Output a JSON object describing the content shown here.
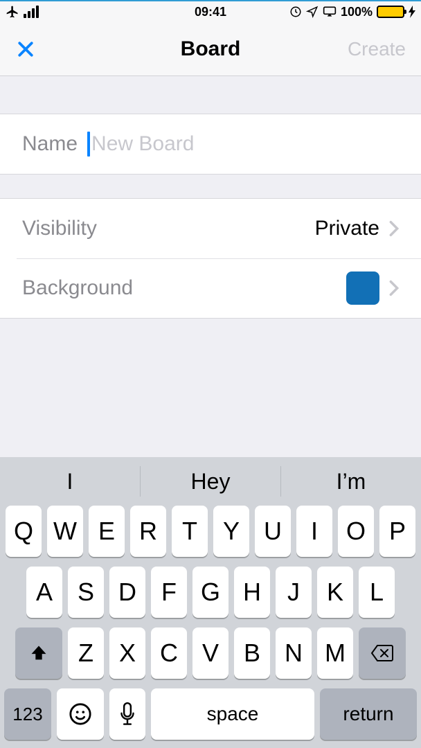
{
  "status": {
    "time": "09:41",
    "battery_pct": "100%"
  },
  "nav": {
    "title": "Board",
    "create_label": "Create"
  },
  "form": {
    "name_label": "Name",
    "name_placeholder": "New Board",
    "visibility_label": "Visibility",
    "visibility_value": "Private",
    "background_label": "Background",
    "background_color": "#1270b6"
  },
  "keyboard": {
    "predictions": [
      "I",
      "Hey",
      "I’m"
    ],
    "row1": [
      "Q",
      "W",
      "E",
      "R",
      "T",
      "Y",
      "U",
      "I",
      "O",
      "P"
    ],
    "row2": [
      "A",
      "S",
      "D",
      "F",
      "G",
      "H",
      "J",
      "K",
      "L"
    ],
    "row3": [
      "Z",
      "X",
      "C",
      "V",
      "B",
      "N",
      "M"
    ],
    "num_label": "123",
    "space_label": "space",
    "return_label": "return"
  }
}
